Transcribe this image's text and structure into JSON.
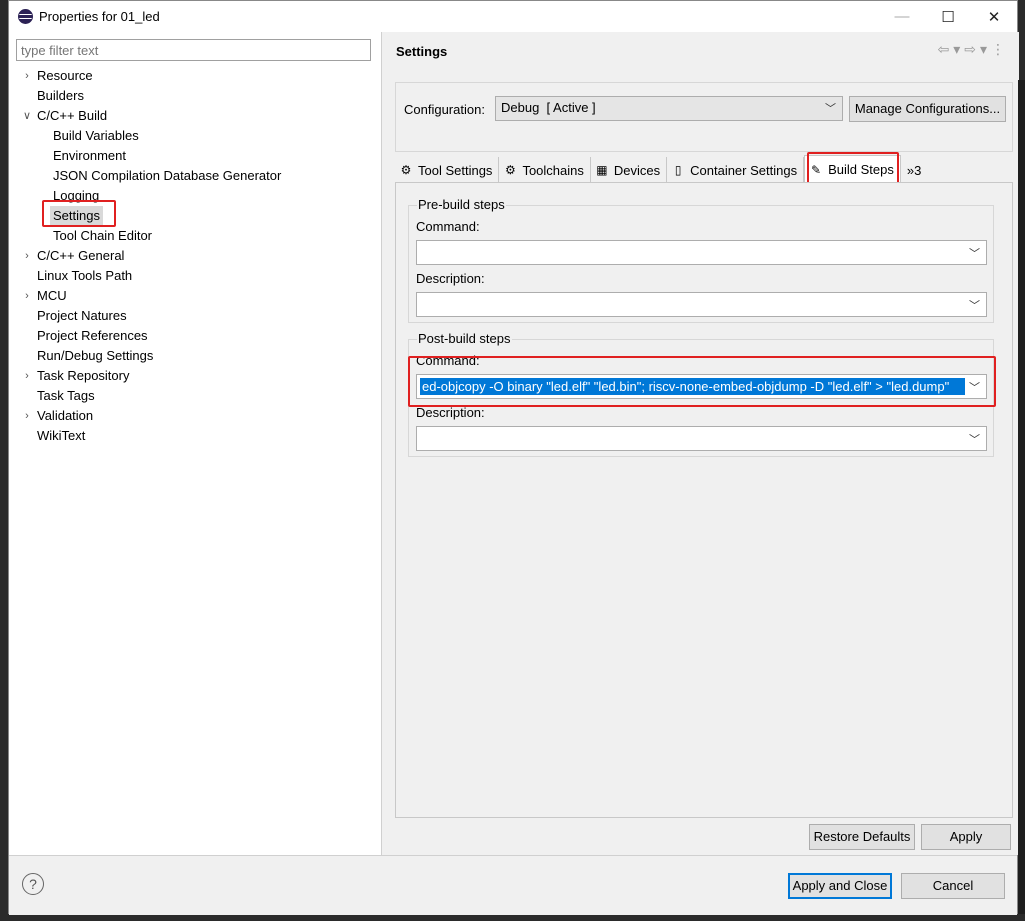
{
  "window": {
    "title": "Properties for 01_led"
  },
  "filter": {
    "placeholder": "type filter text"
  },
  "tree": [
    {
      "label": "Resource",
      "expandable": true,
      "expanded": false,
      "indent": 0
    },
    {
      "label": "Builders",
      "expandable": false,
      "indent": 0
    },
    {
      "label": "C/C++ Build",
      "expandable": true,
      "expanded": true,
      "indent": 0
    },
    {
      "label": "Build Variables",
      "expandable": false,
      "indent": 1
    },
    {
      "label": "Environment",
      "expandable": false,
      "indent": 1
    },
    {
      "label": "JSON Compilation Database Generator",
      "expandable": false,
      "indent": 1
    },
    {
      "label": "Logging",
      "expandable": false,
      "indent": 1
    },
    {
      "label": "Settings",
      "expandable": false,
      "indent": 1,
      "selected": true
    },
    {
      "label": "Tool Chain Editor",
      "expandable": false,
      "indent": 1
    },
    {
      "label": "C/C++ General",
      "expandable": true,
      "expanded": false,
      "indent": 0
    },
    {
      "label": "Linux Tools Path",
      "expandable": false,
      "indent": 0
    },
    {
      "label": "MCU",
      "expandable": true,
      "expanded": false,
      "indent": 0
    },
    {
      "label": "Project Natures",
      "expandable": false,
      "indent": 0
    },
    {
      "label": "Project References",
      "expandable": false,
      "indent": 0
    },
    {
      "label": "Run/Debug Settings",
      "expandable": false,
      "indent": 0
    },
    {
      "label": "Task Repository",
      "expandable": true,
      "expanded": false,
      "indent": 0
    },
    {
      "label": "Task Tags",
      "expandable": false,
      "indent": 0
    },
    {
      "label": "Validation",
      "expandable": true,
      "expanded": false,
      "indent": 0
    },
    {
      "label": "WikiText",
      "expandable": false,
      "indent": 0
    }
  ],
  "settings": {
    "title": "Settings",
    "configuration_label": "Configuration:",
    "configuration_value": "Debug  [ Active ]",
    "manage_button": "Manage Configurations..."
  },
  "tabs": [
    {
      "label": "Tool Settings",
      "icon": "gear-icon"
    },
    {
      "label": "Toolchains",
      "icon": "gear-icon"
    },
    {
      "label": "Devices",
      "icon": "chip-icon"
    },
    {
      "label": "Container Settings",
      "icon": "container-icon"
    },
    {
      "label": "Build Steps",
      "icon": "wand-icon",
      "active": true
    }
  ],
  "tabs_more": "»3",
  "pre_build": {
    "title": "Pre-build steps",
    "command_label": "Command:",
    "command_value": "",
    "description_label": "Description:",
    "description_value": ""
  },
  "post_build": {
    "title": "Post-build steps",
    "command_label": "Command:",
    "command_value": "ed-objcopy -O binary \"led.elf\" \"led.bin\"; riscv-none-embed-objdump -D \"led.elf\" > \"led.dump\"",
    "description_label": "Description:",
    "description_value": ""
  },
  "buttons": {
    "restore_defaults": "Restore Defaults",
    "apply": "Apply",
    "apply_and_close": "Apply and Close",
    "cancel": "Cancel"
  },
  "colors": {
    "selection": "#0078d7",
    "highlight": "#e02020"
  }
}
